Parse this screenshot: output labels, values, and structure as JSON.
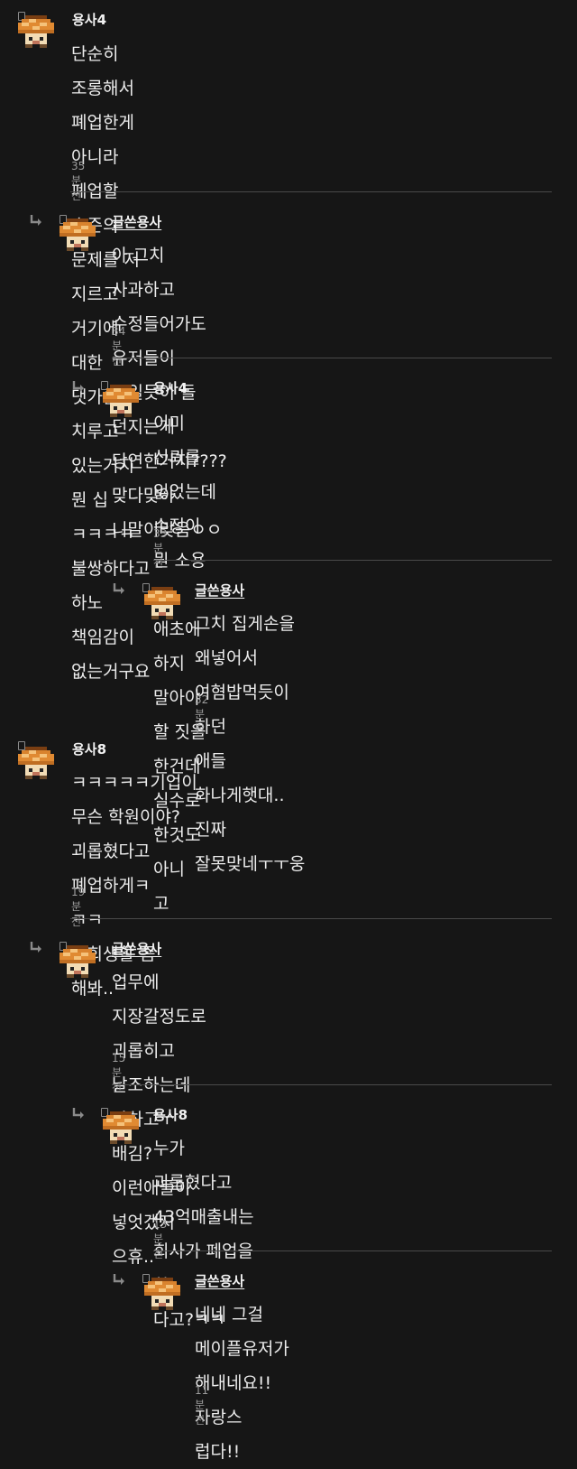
{
  "comments": [
    {
      "username": "용사4",
      "is_writer": false,
      "text": "단순히 조롱해서 폐업한게 아니라 폐업할 수준의 문제를 저\n지르고 거기에 대한 댓가를 치루고 있는거지 뭔 십 ㅋㅋㅋㅋ\n불쌍하다고 하노 책임감이 없는거구요",
      "time": "35분 전"
    },
    {
      "username": "글쓴용사",
      "is_writer": true,
      "text": "아 그치 사과하고 수정들어가도 유저들이 죽일듯이 돌\n던지는게 당연한거지???? 맞다맞아 니말이맞음ㅇㅇ",
      "time": "34분 전"
    },
    {
      "username": "용사4",
      "is_writer": false,
      "text": "이미 신뢰를 잃었는데 수정이 뭔 소용 ㅋ 애초에\n하지 말아야 할 짓을 한건데 실수로 한것도 아니\n고",
      "time": "33분 전"
    },
    {
      "username": "글쓴용사",
      "is_writer": true,
      "text": "그치 집게손을 왜넣어서 여혐밥먹듯이 하던\n애들 화나게햇대.. 진짜 잘못맞네ㅜㅜ웅",
      "time": "32분 전"
    },
    {
      "username": "용사8",
      "is_writer": false,
      "text": "ㅋㅋㅋㅋㅋ기업이 무슨 학원이야? 괴롭혔다고 폐업하게ㅋ\nㅋㅋ\n사회생활 좀 해봐..",
      "time": "19분 전"
    },
    {
      "username": "글쓴용사",
      "is_writer": true,
      "text": "업무에 지장갈정도로 괴롭히고 날조하는데 안하고ㅜ\n배김? 이런애들이 넣엇겠지 으휴..",
      "time": "15분 전"
    },
    {
      "username": "용사8",
      "is_writer": false,
      "text": "누가 괴롭혔다고 43억매출내는 회사가 폐업을 한\n다고?ㅋㅋ",
      "time": "13분 전"
    },
    {
      "username": "글쓴용사",
      "is_writer": true,
      "text": "네네 그걸 메이플유저가 해내네요!! 자랑스\n럽다!!",
      "time": "11분 전"
    }
  ],
  "icons": {
    "avatar": "orange-mushroom-avatar-icon",
    "reply": "reply-arrow-icon",
    "level": "level-badge-icon"
  },
  "colors": {
    "background": "#161616",
    "text": "#ececec",
    "muted": "#9c9c9c",
    "divider": "#4a4a4a",
    "avatar_cap": "#d9832e"
  }
}
